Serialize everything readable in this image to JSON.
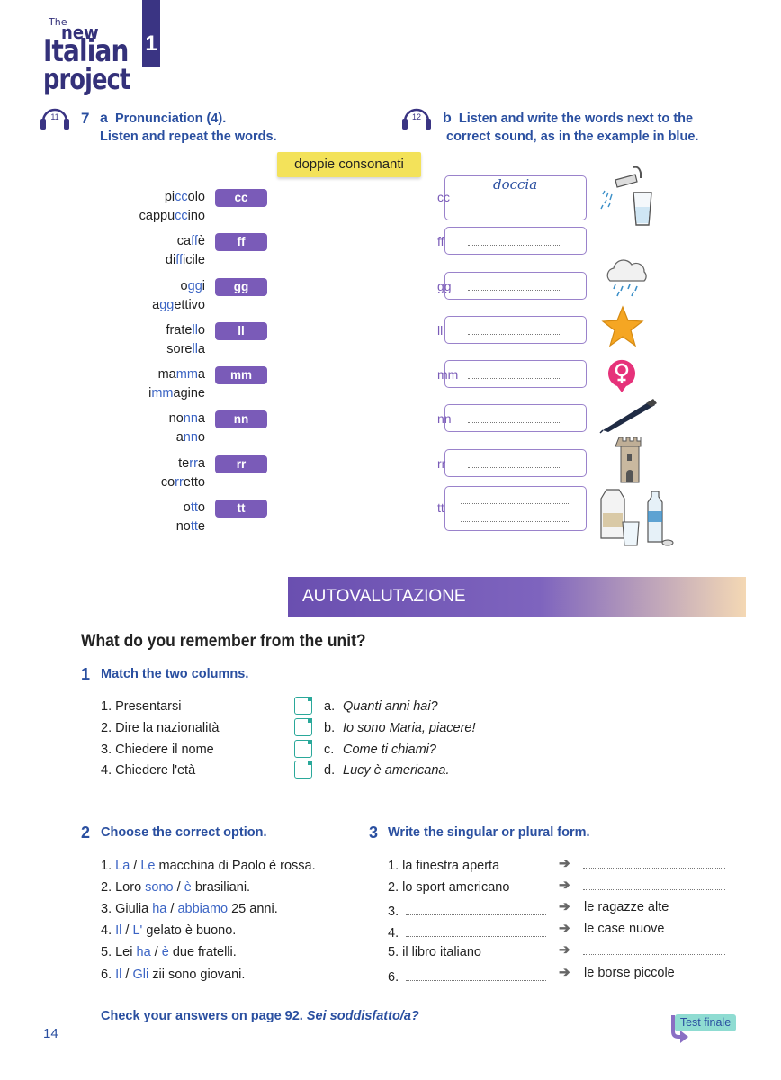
{
  "logo": {
    "the": "The",
    "new": "new",
    "italian": "Italian",
    "project": "project"
  },
  "unit_number": "1",
  "task7a": {
    "track": "11",
    "number": "7",
    "letter": "a",
    "title": "Pronunciation (4).",
    "instruction": "Listen and repeat the words."
  },
  "task7b": {
    "track": "12",
    "letter": "b",
    "line1": "Listen and write the words next to the",
    "line2": "correct sound, as in the example in blue."
  },
  "banner": "doppie consonanti",
  "pairs": [
    {
      "w1": [
        [
          "pi",
          ""
        ],
        [
          "cc",
          "b"
        ],
        [
          "olo",
          ""
        ]
      ],
      "w2": [
        [
          "cappu",
          ""
        ],
        [
          "cc",
          "b"
        ],
        [
          "ino",
          ""
        ]
      ],
      "sound": "cc",
      "example": "doccia"
    },
    {
      "w1": [
        [
          "ca",
          ""
        ],
        [
          "ff",
          "b"
        ],
        [
          "è",
          ""
        ]
      ],
      "w2": [
        [
          "di",
          ""
        ],
        [
          "ff",
          "b"
        ],
        [
          "icile",
          ""
        ]
      ],
      "sound": "ff",
      "example": ""
    },
    {
      "w1": [
        [
          "o",
          ""
        ],
        [
          "gg",
          "b"
        ],
        [
          "i",
          ""
        ]
      ],
      "w2": [
        [
          "a",
          ""
        ],
        [
          "gg",
          "b"
        ],
        [
          "ettivo",
          ""
        ]
      ],
      "sound": "gg",
      "example": ""
    },
    {
      "w1": [
        [
          "frate",
          ""
        ],
        [
          "ll",
          "b"
        ],
        [
          "o",
          ""
        ]
      ],
      "w2": [
        [
          "sore",
          ""
        ],
        [
          "ll",
          "b"
        ],
        [
          "a",
          ""
        ]
      ],
      "sound": "ll",
      "example": ""
    },
    {
      "w1": [
        [
          "ma",
          ""
        ],
        [
          "mm",
          "b"
        ],
        [
          "a",
          ""
        ]
      ],
      "w2": [
        [
          "i",
          ""
        ],
        [
          "mm",
          "b"
        ],
        [
          "agine",
          ""
        ]
      ],
      "sound": "mm",
      "example": ""
    },
    {
      "w1": [
        [
          "no",
          ""
        ],
        [
          "nn",
          "b"
        ],
        [
          "a",
          ""
        ]
      ],
      "w2": [
        [
          "a",
          ""
        ],
        [
          "nn",
          "b"
        ],
        [
          "o",
          ""
        ]
      ],
      "sound": "nn",
      "example": ""
    },
    {
      "w1": [
        [
          "te",
          ""
        ],
        [
          "rr",
          "b"
        ],
        [
          "a",
          ""
        ]
      ],
      "w2": [
        [
          "co",
          ""
        ],
        [
          "rr",
          "b"
        ],
        [
          "etto",
          ""
        ]
      ],
      "sound": "rr",
      "example": ""
    },
    {
      "w1": [
        [
          "o",
          ""
        ],
        [
          "tt",
          "b"
        ],
        [
          "o",
          ""
        ]
      ],
      "w2": [
        [
          "no",
          ""
        ],
        [
          "tt",
          "b"
        ],
        [
          "e",
          ""
        ]
      ],
      "sound": "tt",
      "example": ""
    }
  ],
  "icons": [
    "shower-and-glass-icon",
    "rain-cloud-icon",
    "star-icon",
    "female-symbol-icon",
    "pen-icon",
    "tower-icon",
    "milk-and-water-bottles-icon"
  ],
  "autovalutazione": "AUTOVALUTAZIONE",
  "remember_heading": "What do you remember from the unit?",
  "sec1": {
    "number": "1",
    "title": "Match the two columns.",
    "left": [
      "1.  Presentarsi",
      "2.  Dire la nazionalità",
      "3.  Chiedere il nome",
      "4.  Chiedere l'età"
    ],
    "right_letters": [
      "a.",
      "b.",
      "c.",
      "d."
    ],
    "right": [
      "Quanti anni hai?",
      "Io sono Maria, piacere!",
      "Come ti chiami?",
      "Lucy è americana."
    ]
  },
  "sec2": {
    "number": "2",
    "title": "Choose the correct option.",
    "items": [
      [
        [
          "1.  ",
          ""
        ],
        [
          "La",
          "o"
        ],
        [
          " / ",
          ""
        ],
        [
          "Le",
          "o"
        ],
        [
          " macchina di Paolo è rossa.",
          ""
        ]
      ],
      [
        [
          "2.  Loro ",
          ""
        ],
        [
          "sono",
          "o"
        ],
        [
          " / ",
          ""
        ],
        [
          "è",
          "o"
        ],
        [
          " brasiliani.",
          ""
        ]
      ],
      [
        [
          "3.  Giulia ",
          ""
        ],
        [
          "ha",
          "o"
        ],
        [
          " / ",
          ""
        ],
        [
          "abbiamo",
          "o"
        ],
        [
          " 25 anni.",
          ""
        ]
      ],
      [
        [
          "4.  ",
          ""
        ],
        [
          "Il",
          "o"
        ],
        [
          " / ",
          ""
        ],
        [
          "L'",
          "o"
        ],
        [
          " gelato è buono.",
          ""
        ]
      ],
      [
        [
          "5.  Lei ",
          ""
        ],
        [
          "ha",
          "o"
        ],
        [
          " / ",
          ""
        ],
        [
          "è",
          "o"
        ],
        [
          " due fratelli.",
          ""
        ]
      ],
      [
        [
          "6.  ",
          ""
        ],
        [
          "Il",
          "o"
        ],
        [
          " / ",
          ""
        ],
        [
          "Gli",
          "o"
        ],
        [
          " zii sono giovani.",
          ""
        ]
      ]
    ]
  },
  "sec3": {
    "number": "3",
    "title": "Write the singular or plural form.",
    "items": [
      {
        "left": "1.  la finestra aperta",
        "right": ""
      },
      {
        "left": "2.  lo sport americano",
        "right": ""
      },
      {
        "left": "3.",
        "right": "le ragazze alte"
      },
      {
        "left": "4.",
        "right": "le case nuove"
      },
      {
        "left": "5.  il libro italiano",
        "right": ""
      },
      {
        "left": "6.",
        "right": "le borse piccole"
      }
    ]
  },
  "footer": {
    "check": "Check your answers on page 92.",
    "question": "Sei soddisfatto/a?",
    "page": "14",
    "test_finale": "Test finale"
  },
  "colors": {
    "purple": "#7a5bb8",
    "blue": "#2a4fa0",
    "yellow": "#f3e25a",
    "teal": "#2aa89a"
  }
}
